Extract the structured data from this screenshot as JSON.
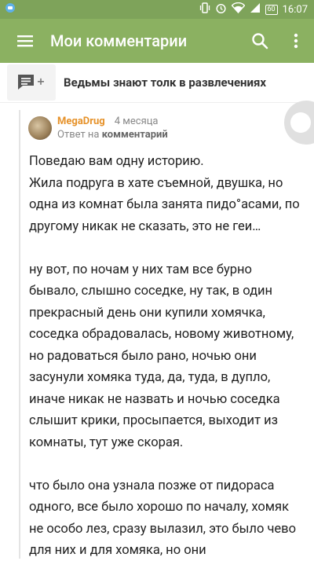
{
  "status_bar": {
    "time": "16:07",
    "battery": "60",
    "icons": [
      "message-icon",
      "vibrate-icon",
      "alarm-icon",
      "wifi-icon",
      "signal-icon",
      "battery-icon"
    ]
  },
  "appbar": {
    "title": "Мои комментарии",
    "colors": {
      "status": "#7ea35a",
      "bar": "#8bb161"
    }
  },
  "post": {
    "title": "Ведьмы знают толк в развлечениях"
  },
  "comment": {
    "author": "MegaDrug",
    "age": "4 месяца",
    "reply_prefix": "Ответ на",
    "reply_target": "комментарий",
    "paragraphs": [
      "Поведаю вам одну историю.\nЖила подруга в хате съемной, двушка, но одна из комнат была занята пидо°асами, по другому никак не сказать, это не геи…",
      "ну вот, по ночам у них там все бурно бывало, слышно соседке, ну так, в один прекрасный день они купили хомячка, соседка обрадовалась, новому животному, но радоваться было рано, ночью они засунули хомяка туда, да, туда, в дупло, иначе никак не назвать и ночью соседка слышит крики, просыпается, выходит из комнаты, тут уже скорая.",
      "что было она узнала позже от пидораса одного, все было хорошо по началу, хомяк не особо лез, сразу вылазил, это было чево для них и для хомяка, но они"
    ]
  }
}
